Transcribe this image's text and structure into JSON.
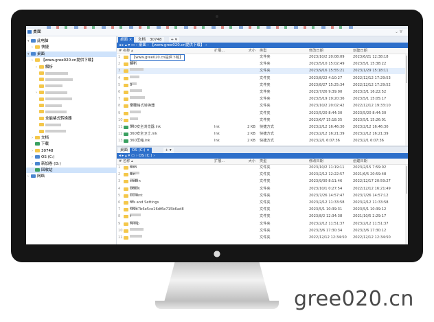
{
  "address": {
    "text": "桌面",
    "right": "⌄ ∀"
  },
  "tree": [
    {
      "label": "此电脑",
      "icon": "pc-icon",
      "indent": 1,
      "tw": "▾"
    },
    {
      "label": "快捷",
      "icon": "folder-icon",
      "indent": 2,
      "tw": "›"
    },
    {
      "label": "桌面",
      "icon": "desktop-icon",
      "indent": 1,
      "tw": "▾",
      "sel": true
    },
    {
      "label": "【www.gree020.cn提供下载】",
      "icon": "folder-icon",
      "indent": 2,
      "tw": "›"
    },
    {
      "label": "解析",
      "icon": "folder-icon",
      "indent": 3,
      "tw": "›"
    },
    {
      "label": "",
      "icon": "folder-icon",
      "indent": 3,
      "tw": ""
    },
    {
      "label": "",
      "icon": "folder-icon",
      "indent": 3,
      "tw": ""
    },
    {
      "label": "",
      "icon": "folder-icon",
      "indent": 3,
      "tw": ""
    },
    {
      "label": "",
      "icon": "folder-icon",
      "indent": 3,
      "tw": "›"
    },
    {
      "label": "",
      "icon": "folder-icon",
      "indent": 3,
      "tw": ""
    },
    {
      "label": "",
      "icon": "folder-icon",
      "indent": 3,
      "tw": ""
    },
    {
      "label": "",
      "icon": "folder-icon",
      "indent": 3,
      "tw": ""
    },
    {
      "label": "全能格式转换器",
      "icon": "folder-icon",
      "indent": 3,
      "tw": ""
    },
    {
      "label": "",
      "icon": "folder-icon",
      "indent": 3,
      "tw": ""
    },
    {
      "label": "",
      "icon": "folder-icon",
      "indent": 3,
      "tw": ""
    },
    {
      "label": "文档",
      "icon": "folder-icon",
      "indent": 2,
      "tw": "›"
    },
    {
      "label": "下载",
      "icon": "download-icon",
      "indent": 2,
      "tw": ""
    },
    {
      "label": "30748",
      "icon": "folder-icon",
      "indent": 2,
      "tw": "›"
    },
    {
      "label": "OS (C:)",
      "icon": "drive-icon",
      "indent": 2,
      "tw": "›"
    },
    {
      "label": "新加卷 (D:)",
      "icon": "drive-icon",
      "indent": 2,
      "tw": "›"
    },
    {
      "label": "回收站",
      "icon": "recycle-icon",
      "indent": 2,
      "tw": "",
      "sel": true
    },
    {
      "label": "网络",
      "icon": "network-icon",
      "indent": 1,
      "tw": "›"
    }
  ],
  "top_pane": {
    "tabs": [
      {
        "label": "桌面 ×",
        "active": true
      },
      {
        "label": "文档",
        "active": false
      },
      {
        "label": "30748",
        "active": false
      },
      {
        "label": "+ ▾",
        "active": false
      }
    ],
    "path": "◂ ▸ ▴ ▾  ▭ ›  桌面 ›  【www.gree020.cn提供下载】 ›",
    "columns": {
      "name": "# 名称 ▴",
      "ext": "扩展...",
      "size": "大小",
      "type": "类型",
      "modified": "修改日期",
      "created": "创建日期"
    },
    "rows": [
      {
        "n": "1",
        "name": "【www.gree020.cn提供下载】",
        "ext": "",
        "size": "",
        "type": "文件夹",
        "modified": "2023/10/2 20:08:09",
        "created": "2023/6/21 12:38:18",
        "hl": true
      },
      {
        "n": "2",
        "name": "解析",
        "ext": "",
        "size": "",
        "type": "文件夹",
        "modified": "2023/5/10 15:02:49",
        "created": "2023/5/1 15:38:22",
        "blur": 8
      },
      {
        "n": "3",
        "name": "",
        "ext": "",
        "size": "",
        "type": "文件夹",
        "modified": "2023/9/16 15:55:21",
        "created": "2023/1/29 15:18:11",
        "blur": 20,
        "sel": true
      },
      {
        "n": "4",
        "name": "",
        "ext": "",
        "size": "",
        "type": "文件夹",
        "modified": "2023/8/22 4:10:27",
        "created": "2022/12/12 17:29:53",
        "blur": 14
      },
      {
        "n": "5",
        "name": "3",
        "ext": "",
        "size": "",
        "type": "文件夹",
        "modified": "2023/8/27 15:25:34",
        "created": "2022/12/12 17:29:52",
        "blur": 10
      },
      {
        "n": "6",
        "name": "",
        "ext": "",
        "size": "",
        "type": "文件夹",
        "modified": "2023/7/26 9:39:00",
        "created": "2023/3/1 16:22:52",
        "blur": 18
      },
      {
        "n": "7",
        "name": "",
        "ext": "",
        "size": "",
        "type": "文件夹",
        "modified": "2023/5/19 19:20:36",
        "created": "2023/5/1 15:05:17",
        "blur": 22
      },
      {
        "n": "8",
        "name": "全能格式转换器",
        "ext": "",
        "size": "",
        "type": "文件夹",
        "modified": "2023/10/2 20:02:42",
        "created": "2022/12/12 19:33:10",
        "blur": 10
      },
      {
        "n": "9",
        "name": "",
        "ext": "",
        "size": "",
        "type": "文件夹",
        "modified": "2023/5/20 8:44:30",
        "created": "2023/5/20 8:44:30",
        "blur": 16
      },
      {
        "n": "10",
        "name": "",
        "ext": "",
        "size": "",
        "type": "文件夹",
        "modified": "2023/6/7 15:18:35",
        "created": "2023/5/1 15:26:01",
        "blur": 12
      },
      {
        "n": "11",
        "name": "360安全浏览器.lnk",
        "ext": "lnk",
        "size": "2 KB",
        "type": "快捷方式",
        "modified": "2023/2/12 16:46:30",
        "created": "2023/2/12 16:46:30",
        "blur": 6,
        "lnk": true
      },
      {
        "n": "12",
        "name": "360安全卫士.lnk",
        "ext": "lnk",
        "size": "2 KB",
        "type": "快捷方式",
        "modified": "2023/2/12 16:21:39",
        "created": "2023/2/12 16:21:39",
        "lnk": true
      },
      {
        "n": "13",
        "name": "360压缩.lnk",
        "ext": "lnk",
        "size": "2 KB",
        "type": "快捷方式",
        "modified": "2023/2/1 6:07:36",
        "created": "2023/2/1 6:07:36",
        "lnk": true
      }
    ]
  },
  "bottom_pane": {
    "tabs": [
      {
        "label": "桌面",
        "active": false
      },
      {
        "label": "OS (C:) ×",
        "active": true
      },
      {
        "label": "+ ▾",
        "active": false
      }
    ],
    "path": "◂ ▸ ▴ ▾  ▭ ›  OS (C:) ›",
    "columns": {
      "name": "# 名称 ▴",
      "ext": "扩展...",
      "size": "大小",
      "type": "类型",
      "modified": "修改日期",
      "created": "创建日期"
    },
    "rows": [
      {
        "n": "1",
        "name": "tion",
        "type": "文件夹",
        "modified": "2023/10/2 11:19:11",
        "created": "2023/2/15 7:59:02",
        "blur": 10
      },
      {
        "n": "2",
        "name": "Bin",
        "type": "文件夹",
        "modified": "2023/2/12 12:22:57",
        "created": "2021/6/5 20:59:48",
        "blur": 14
      },
      {
        "n": "3",
        "name": "cleBin",
        "type": "文件夹",
        "modified": "2023/9/30 8:11:46",
        "created": "2022/12/17 20:59:27",
        "blur": 12
      },
      {
        "n": "4",
        "name": "DBOX",
        "type": "文件夹",
        "modified": "2023/10/1 0:27:54",
        "created": "2022/12/12 16:21:49",
        "blur": 12
      },
      {
        "n": "5",
        "name": "CClient",
        "type": "文件夹",
        "modified": "2023/7/26 14:57:47",
        "created": "2023/7/26 14:57:12",
        "blur": 12
      },
      {
        "n": "6",
        "name": "nts and Settings",
        "type": "文件夹",
        "modified": "2023/2/12 11:33:58",
        "created": "2023/2/12 11:33:58",
        "blur": 6
      },
      {
        "n": "7",
        "name": "f39d7b6e5ce16df6e715b6ad8",
        "type": "文件夹",
        "modified": "2023/5/1 10:39:31",
        "created": "2023/5/1 10:39:12",
        "blur": 10
      },
      {
        "n": "8",
        "name": "t",
        "type": "文件夹",
        "modified": "2023/8/2 12:34:38",
        "created": "2021/10/5 2:29:17",
        "blur": 16
      },
      {
        "n": "9",
        "name": "Temp",
        "type": "文件夹",
        "modified": "2023/2/12 11:51:37",
        "created": "2023/2/12 11:51:37",
        "blur": 12
      },
      {
        "n": "10",
        "name": "",
        "type": "文件夹",
        "modified": "2023/3/6 17:30:34",
        "created": "2023/3/6 17:30:12",
        "blur": 20
      },
      {
        "n": "11",
        "name": "",
        "type": "文件夹",
        "modified": "2022/12/12 12:34:50",
        "created": "2022/12/12 12:34:50",
        "blur": 18
      }
    ]
  },
  "watermark": "gree020.cn"
}
